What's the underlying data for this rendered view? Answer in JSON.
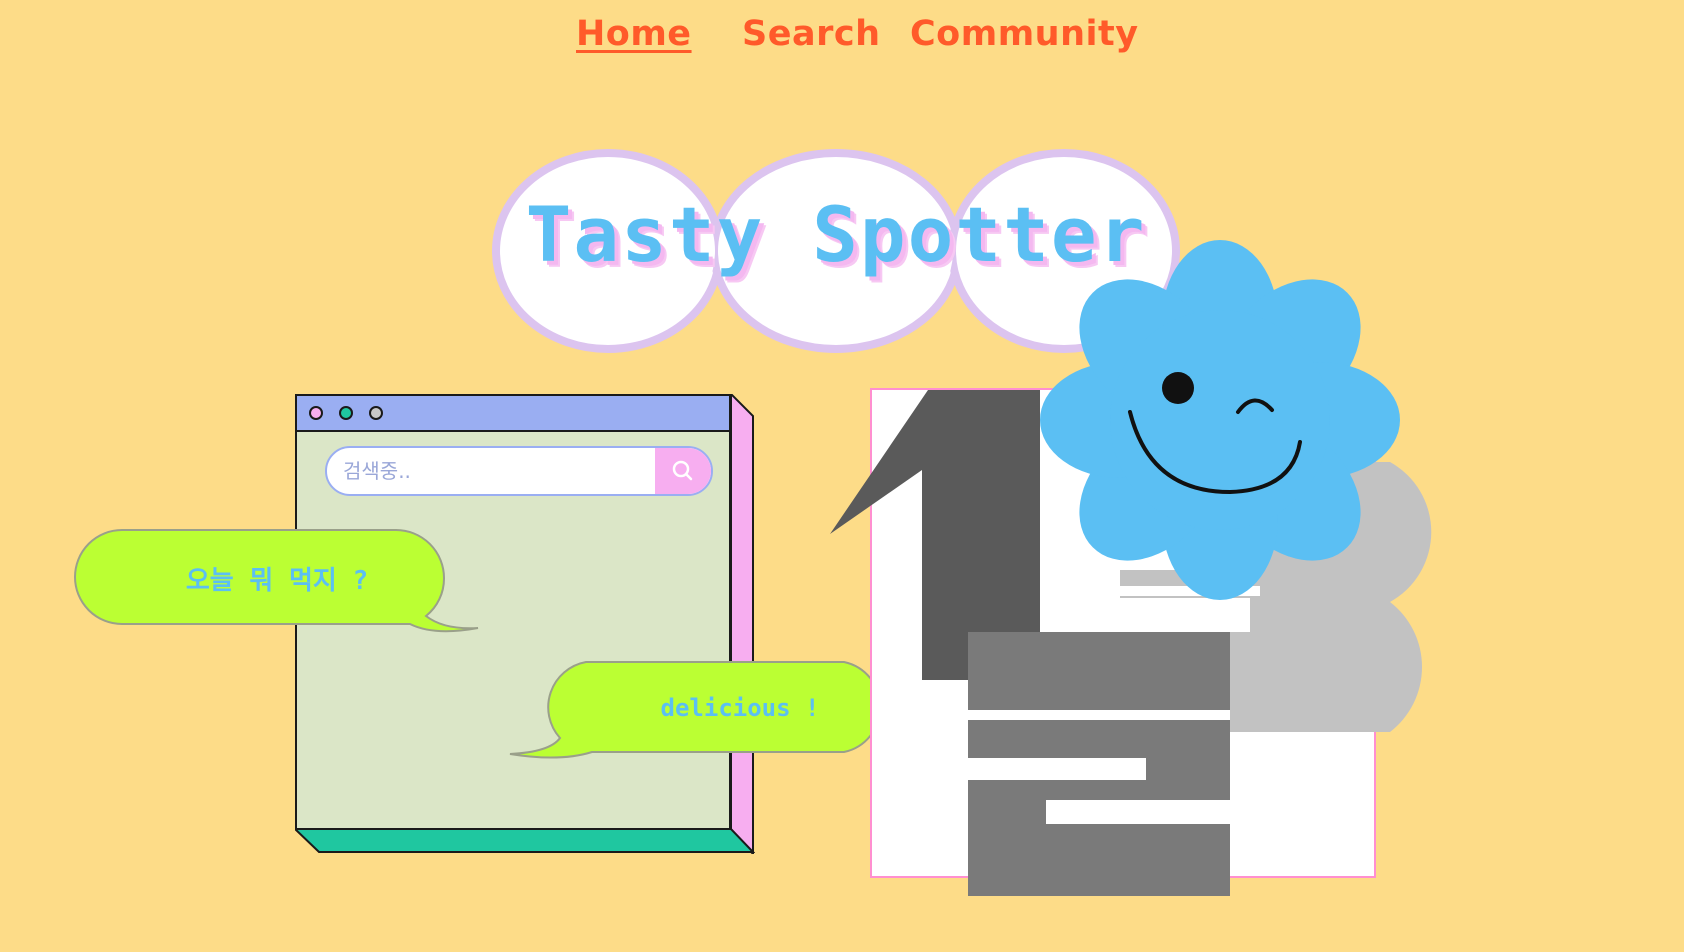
{
  "nav": {
    "items": [
      {
        "label": "Home",
        "active": true
      },
      {
        "label": "Search",
        "active": false
      },
      {
        "label": "Community",
        "active": false
      }
    ]
  },
  "hero": {
    "title": "Tasty Spotter"
  },
  "browser": {
    "dots": [
      "#f7aef0",
      "#1fc7a0",
      "#c8c8c8"
    ],
    "search_placeholder": "검색중..",
    "search_icon": "search-icon"
  },
  "bubbles": {
    "question": "오늘 뭐 먹지 ?",
    "answer": "delicious !"
  },
  "poster": {
    "icon": "number-collage"
  },
  "mascot": {
    "icon": "winking-flower-icon"
  },
  "colors": {
    "background": "#fddc88",
    "nav_text": "#ff5a2a",
    "title_text": "#5bbff3",
    "bubble_fill": "#bbff33",
    "browser_titlebar": "#9aaef2",
    "browser_body": "#dbe6c7",
    "flower": "#5bbff3"
  }
}
